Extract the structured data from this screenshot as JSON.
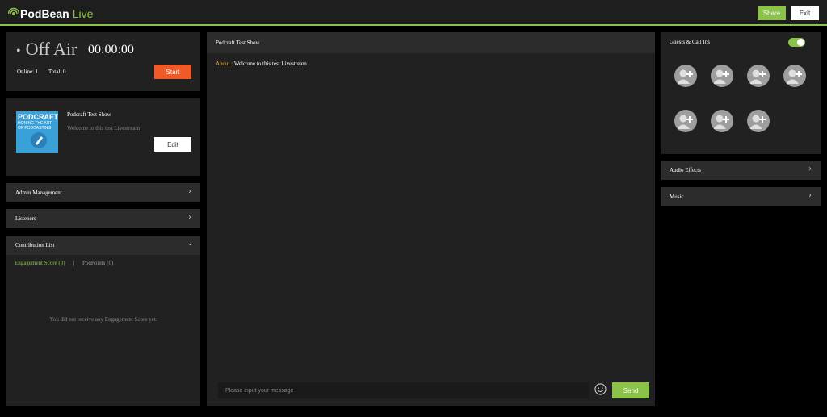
{
  "topbar": {
    "logo_text": "PodBean",
    "logo_suffix": "Live",
    "share_label": "Share",
    "exit_label": "Exit"
  },
  "status": {
    "state": "Off Air",
    "timer": "00:00:00",
    "online": "Online: 1",
    "total": "Total: 0",
    "start_label": "Start"
  },
  "show": {
    "cover_title": "PODCRAFT",
    "cover_subtitle": "HONING THE ART OF PODCASTING",
    "title": "Podcraft Test Show",
    "description": "Welcome to this test Livestream",
    "edit_label": "Edit"
  },
  "left_sections": [
    {
      "label": "Admin Management"
    },
    {
      "label": "Listeners"
    }
  ],
  "contribution": {
    "title": "Contribution List",
    "tab_engagement": "Engagement Score (0)",
    "tab_separator": "|",
    "tab_podpoints": "PodPoints (0)",
    "empty_text": "You did not receive any Engagement Score yet."
  },
  "chat": {
    "title": "Podcraft Test Show",
    "about_label": "About :",
    "about_text": "Welcome to this test Livestream",
    "input_placeholder": "Please input your message",
    "send_label": "Send"
  },
  "guests": {
    "title": "Guests & Call Ins",
    "toggle_on": true,
    "slot_count": 7
  },
  "right_sections": [
    {
      "label": "Audio Effects"
    },
    {
      "label": "Music"
    }
  ],
  "colors": {
    "accent": "#8bc34a",
    "start": "#f05a28",
    "panel": "#212121",
    "header": "#2c2c2c"
  }
}
